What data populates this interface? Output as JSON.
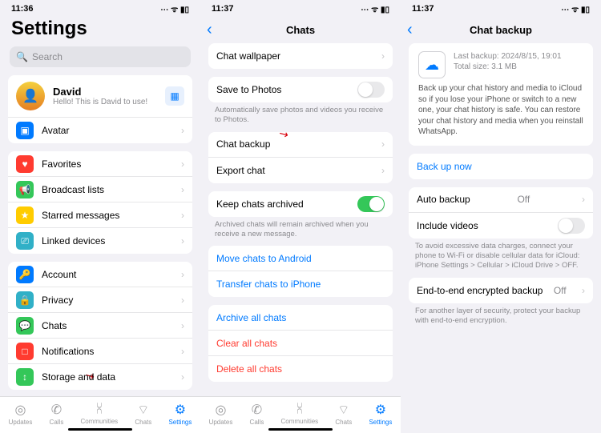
{
  "status": {
    "time1": "11:36",
    "time2": "11:37",
    "time3": "11:37"
  },
  "p1": {
    "title": "Settings",
    "searchPlaceholder": "Search",
    "profile": {
      "name": "David",
      "status": "Hello! This is David to use!"
    },
    "avatar": "Avatar",
    "list1": [
      "Favorites",
      "Broadcast lists",
      "Starred messages",
      "Linked devices"
    ],
    "list2": [
      "Account",
      "Privacy",
      "Chats",
      "Notifications",
      "Storage and data"
    ]
  },
  "p2": {
    "title": "Chats",
    "wallpaper": "Chat wallpaper",
    "savePhotos": "Save to Photos",
    "savePhotosCap": "Automatically save photos and videos you receive to Photos.",
    "chatBackup": "Chat backup",
    "exportChat": "Export chat",
    "keepArchived": "Keep chats archived",
    "keepArchivedCap": "Archived chats will remain archived when you receive a new message.",
    "moveAndroid": "Move chats to Android",
    "transferIphone": "Transfer chats to iPhone",
    "archiveAll": "Archive all chats",
    "clearAll": "Clear all chats",
    "deleteAll": "Delete all chats"
  },
  "p3": {
    "title": "Chat backup",
    "lastBackup": "Last backup: 2024/8/15, 19:01",
    "totalSize": "Total size: 3.1 MB",
    "desc": "Back up your chat history and media to iCloud so if you lose your iPhone or switch to a new one, your chat history is safe. You can restore your chat history and media when you reinstall WhatsApp.",
    "backupNow": "Back up now",
    "autoBackup": "Auto backup",
    "autoBackupVal": "Off",
    "includeVideos": "Include videos",
    "dataCap": "To avoid excessive data charges, connect your phone to Wi-Fi or disable cellular data for iCloud: iPhone Settings > Cellular > iCloud Drive > OFF.",
    "e2e": "End-to-end encrypted backup",
    "e2eVal": "Off",
    "e2eCap": "For another layer of security, protect your backup with end-to-end encryption."
  },
  "tabs": [
    "Updates",
    "Calls",
    "Communities",
    "Chats",
    "Settings"
  ]
}
